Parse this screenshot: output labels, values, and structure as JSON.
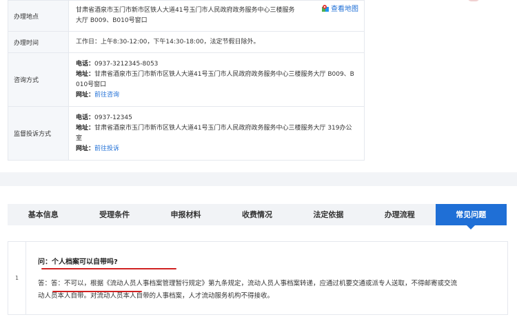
{
  "rows": [
    {
      "label": "办理地点",
      "lines": [
        "甘肃省酒泉市玉门市新市区铁人大道41号玉门市人民政府政务服务中心三楼服务",
        "大厅 B009、B010号窗口"
      ],
      "map_link": "查看地图"
    },
    {
      "label": "办理时间",
      "text": "工作日：上午8:30-12:00，下午14:30-18:00，法定节假日除外。"
    },
    {
      "label": "咨询方式",
      "phone_label": "电话：",
      "phone": "0937-3212345-8053",
      "addr_label": "地址：",
      "addr_lines": [
        "甘肃省酒泉市玉门市新市区铁人大道41号玉门市人民政府政务服务中心三楼服务大厅 B009、B",
        "010号窗口"
      ],
      "web_label": "网址：",
      "web_link": "前往咨询"
    },
    {
      "label": "监督投诉方式",
      "phone_label": "电话：",
      "phone": "0937-12345",
      "addr_label": "地址：",
      "addr_lines": [
        "甘肃省酒泉市玉门市新市区铁人大道41号玉门市人民政府政务服务中心三楼服务大厅 319办公",
        "室"
      ],
      "web_label": "网址：",
      "web_link": "前往投诉"
    }
  ],
  "tabs": [
    "基本信息",
    "受理条件",
    "申报材料",
    "收费情况",
    "法定依据",
    "办理流程",
    "常见问题"
  ],
  "active_tab": "常见问题",
  "faq": {
    "num": "1",
    "question": "问：个人档案可以自带吗?",
    "answer_lines": [
      "答：答：不可以，根据《流动人员人事档案管理暂行规定》第九条规定，流动人员人事档案转递，应通过机要交通或派专人送取，不得邮寄或交流",
      "动人员本人自带。对流动人员本人自带的人事档案，人才流动服务机构不得接收。"
    ]
  },
  "colors": {
    "accent": "#1f6fd6",
    "underline": "#d02020"
  },
  "icons": {
    "map": "map-pin-icon"
  }
}
